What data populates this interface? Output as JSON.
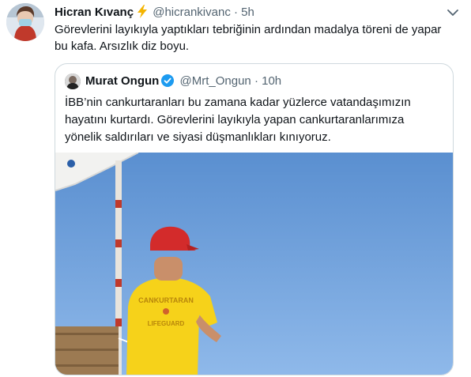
{
  "tweet": {
    "author_name": "Hicran Kıvanç",
    "emoji_icon": "lightning-bolt-icon",
    "handle": "@hicrankivanc",
    "separator": "·",
    "time": "5h",
    "text": "Görevlerini layıkıyla yaptıkları tebriğinin ardından madalya töreni de yapar bu kafa. Arsızlık diz boyu."
  },
  "quoted": {
    "author_name": "Murat Ongun",
    "handle": "@Mrt_Ongun",
    "separator": "·",
    "time": "10h",
    "text": "İBB’nin cankurtaranları bu zamana kadar yüzlerce vatandaşımızın hayatını kurtardı. Görevlerini layıkıyla yapan cankurtaranlarımıza yönelik saldırıları ve siyasi düşmanlıkları kınıyoruz.",
    "image": {
      "shirt_text_1": "CANKURTARAN",
      "shirt_text_2": "LIFEGUARD"
    }
  },
  "colors": {
    "text": "#0f1419",
    "muted": "#536471",
    "border": "#cfd9de",
    "verified": "#1d9bf0",
    "sky_top": "#5a8fd0",
    "sky_bottom": "#8fb9ea",
    "shirt": "#f6d21a",
    "cap": "#d32b2b"
  }
}
